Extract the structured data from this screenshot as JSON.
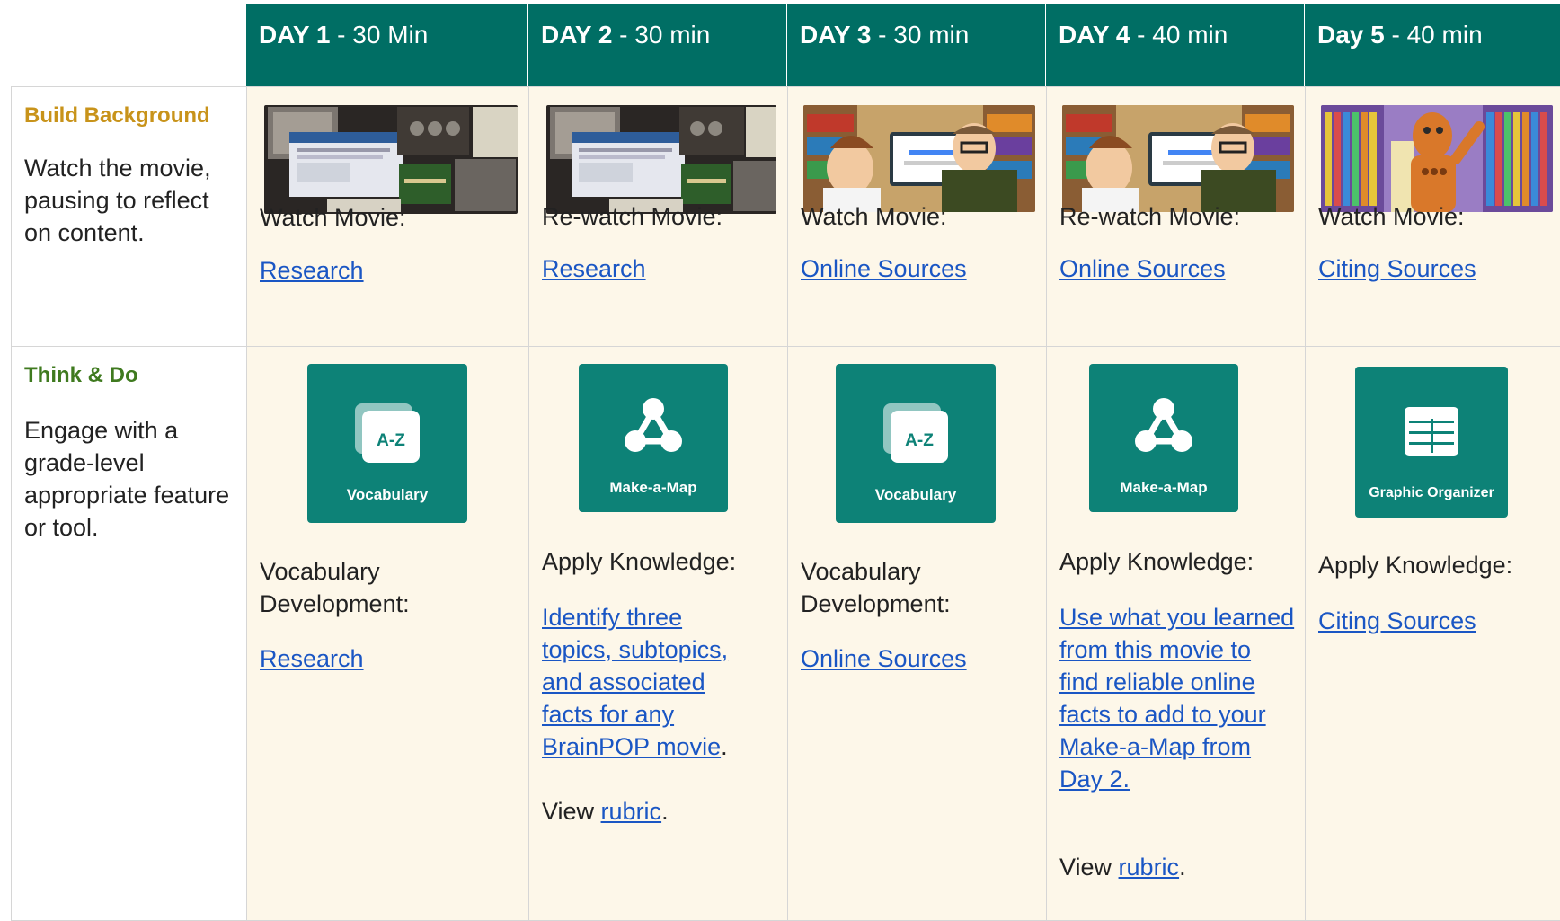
{
  "header": {
    "days": [
      {
        "day": "DAY 1",
        "duration": " - 30 Min"
      },
      {
        "day": "DAY 2",
        "duration": " - 30 min"
      },
      {
        "day": "DAY 3",
        "duration": " - 30 min"
      },
      {
        "day": "DAY 4",
        "duration": " - 40 min"
      },
      {
        "day": "Day 5",
        "duration": " - 40 min"
      }
    ]
  },
  "rows": {
    "build": {
      "title": "Build Background",
      "description": "Watch the movie, pausing to reflect on content.",
      "cells": [
        {
          "action": "Watch Movie:",
          "link": "Research",
          "thumb": "research-movie-thumbnail"
        },
        {
          "action": "Re-watch Movie:",
          "link": "Research",
          "thumb": "research-movie-thumbnail"
        },
        {
          "action": "Watch Movie:",
          "link": "Online Sources",
          "thumb": "online-sources-movie-thumbnail"
        },
        {
          "action": "Re-watch Movie:",
          "link": "Online Sources",
          "thumb": "online-sources-movie-thumbnail"
        },
        {
          "action": "Watch Movie:",
          "link": "Citing Sources",
          "thumb": "citing-sources-movie-thumbnail"
        }
      ]
    },
    "think": {
      "title": "Think & Do",
      "description": "Engage with a grade-level appropriate feature or tool.",
      "cells": [
        {
          "tile": "Vocabulary",
          "icon": "vocabulary-icon",
          "action": "Vocabulary Development:",
          "link": "Research"
        },
        {
          "tile": "Make-a-Map",
          "icon": "make-a-map-icon",
          "action": "Apply Knowledge:",
          "link": "Identify three topics, subtopics, and associated facts for any BrainPOP movie",
          "suffix": ".",
          "view_prefix": "View ",
          "view_link": "rubric",
          "view_suffix": "."
        },
        {
          "tile": "Vocabulary",
          "icon": "vocabulary-icon",
          "action": "Vocabulary Development:",
          "link": "Online Sources"
        },
        {
          "tile": "Make-a-Map",
          "icon": "make-a-map-icon",
          "action": "Apply Knowledge:",
          "link": "Use what you learned from this movie to find reliable online facts to add to your Make-a-Map from Day 2.",
          "view_prefix": "View ",
          "view_link": "rubric",
          "view_suffix": "."
        },
        {
          "tile": "Graphic Organizer",
          "icon": "graphic-organizer-icon",
          "action": "Apply Knowledge:",
          "link": "Citing Sources"
        }
      ]
    }
  },
  "colors": {
    "header_bg": "#006e64",
    "cell_bg": "#fdf7e9",
    "tile_bg": "#0d8277",
    "link": "#1a56c4",
    "build_title": "#c8931a",
    "think_title": "#3f7a1f"
  }
}
